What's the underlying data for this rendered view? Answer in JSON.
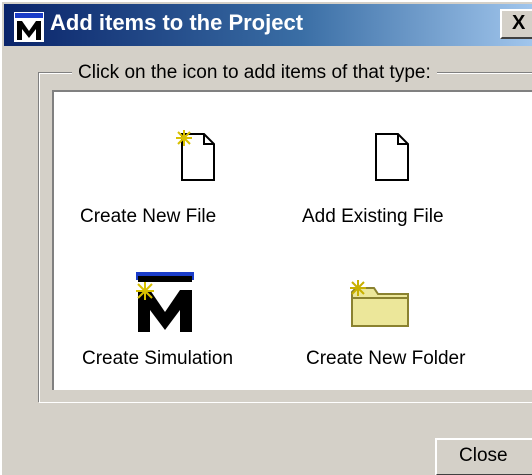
{
  "window": {
    "title": "Add items to the Project",
    "close_glyph": "X",
    "title_bar_colors": [
      "#0a246a",
      "#3a6ea5",
      "#a6caf0"
    ],
    "face_color": "#d4d0c8"
  },
  "app_icon": {
    "glyph": "M",
    "name": "matlab-m-icon"
  },
  "group": {
    "legend": "Click on the icon to add items of that type:"
  },
  "items": [
    {
      "label": "Create New File",
      "icon": "new-file-icon"
    },
    {
      "label": "Add Existing File",
      "icon": "existing-file-icon"
    },
    {
      "label": "Create Simulation",
      "icon": "simulation-m-icon"
    },
    {
      "label": "Create New Folder",
      "icon": "new-folder-icon"
    }
  ],
  "buttons": {
    "close_label": "Close"
  }
}
